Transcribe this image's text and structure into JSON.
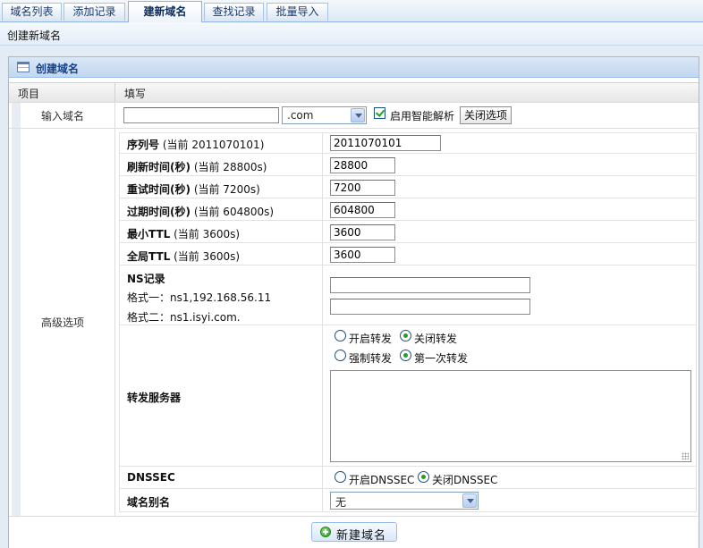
{
  "tabs": [
    {
      "label": "域名列表",
      "active": false
    },
    {
      "label": "添加记录",
      "active": false
    },
    {
      "label": "建新域名",
      "active": true
    },
    {
      "label": "查找记录",
      "active": false
    },
    {
      "label": "批量导入",
      "active": false
    }
  ],
  "breadcrumb": "创建新域名",
  "panel": {
    "title": "创建域名",
    "col_item": "项目",
    "col_fill": "填写"
  },
  "domain_row": {
    "label": "输入域名",
    "input_value": "",
    "suffix_selected": ".com",
    "smart_parse_label": "启用智能解析",
    "smart_parse_checked": true,
    "close_options_label": "关闭选项"
  },
  "advanced": {
    "label": "高级选项",
    "serial": {
      "label": "序列号",
      "hint": "(当前 2011070101)",
      "value": "2011070101"
    },
    "refresh": {
      "label": "刷新时间(秒)",
      "hint": "(当前 28800s)",
      "value": "28800"
    },
    "retry": {
      "label": "重试时间(秒)",
      "hint": "(当前 7200s)",
      "value": "7200"
    },
    "expire": {
      "label": "过期时间(秒)",
      "hint": "(当前 604800s)",
      "value": "604800"
    },
    "min_ttl": {
      "label": "最小TTL",
      "hint": "(当前 3600s)",
      "value": "3600"
    },
    "global_ttl": {
      "label": "全局TTL",
      "hint": "(当前 3600s)",
      "value": "3600"
    },
    "ns": {
      "label": "NS记录",
      "format1": "格式一：ns1,192.168.56.11",
      "format2": "格式二：ns1.isyi.com.",
      "value1": "",
      "value2": ""
    },
    "forward": {
      "label": "转发服务器",
      "enable_label": "开启转发",
      "disable_label": "关闭转发",
      "selected_state": "关闭转发",
      "force_label": "强制转发",
      "first_label": "第一次转发",
      "selected_mode": "第一次转发",
      "servers": ""
    },
    "dnssec": {
      "label": "DNSSEC",
      "enable_label": "开启DNSSEC",
      "disable_label": "关闭DNSSEC",
      "selected": "关闭DNSSEC"
    },
    "alias": {
      "label": "域名别名",
      "selected": "无"
    }
  },
  "submit_label": "新建域名"
}
